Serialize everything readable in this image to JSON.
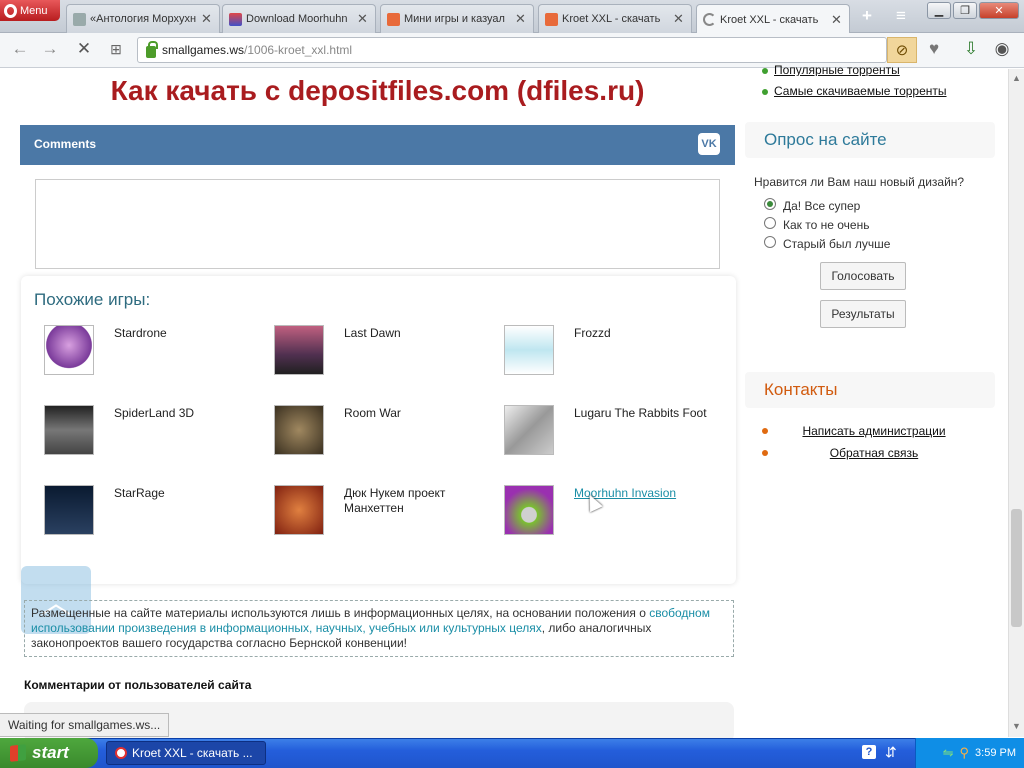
{
  "browser": {
    "menu_label": "Menu",
    "tabs": [
      {
        "title": "«Антология Морхухн"
      },
      {
        "title": "Download Moorhuhn"
      },
      {
        "title": "Мини игры и казуал"
      },
      {
        "title": "Kroet XXL - скачать"
      },
      {
        "title": "Kroet XXL - скачать"
      }
    ],
    "url_host": "smallgames.ws",
    "url_path": "/1006-kroet_xxl.html",
    "status": "Waiting for smallgames.ws..."
  },
  "page": {
    "download_heading": "Как качать с depositfiles.com (dfiles.ru)",
    "comments_label": "Comments",
    "vk_label": "VK",
    "similar_title": "Похожие игры:",
    "similar_games": [
      {
        "name": "Stardrone",
        "color": "#c070c0"
      },
      {
        "name": "Last Dawn",
        "color": "#804060"
      },
      {
        "name": "Frozzd",
        "color": "#bfe6f0"
      },
      {
        "name": "SpiderLand 3D",
        "color": "#555555"
      },
      {
        "name": "Room War",
        "color": "#6b5a3a"
      },
      {
        "name": "Lugaru The Rabbits Foot",
        "color": "#b8bcc0"
      },
      {
        "name": "StarRage",
        "color": "#1a2a40"
      },
      {
        "name": "Дюк Нукем проект Манхеттен",
        "color": "#a04020"
      },
      {
        "name": "Moorhuhn Invasion",
        "color": "#8a2aa0"
      }
    ],
    "disclaimer": {
      "part1": "Размещенные на сайте материалы используются лишь в информационных целях, на основании положения о ",
      "link1": "свободном использовании произведения в информационных, научных, учебных или культурных целях",
      "part2": ", либо аналогичных законопроектов вашего государства согласно Бернской конвенции!"
    },
    "user_comments_title": "Комментарии от пользователей сайта"
  },
  "sidebar": {
    "torrent_links": [
      "Популярные торренты",
      "Самые скачиваемые торренты"
    ],
    "poll": {
      "title": "Опрос на сайте",
      "question": "Нравится ли Вам наш новый дизайн?",
      "options": [
        {
          "label": "Да! Все супер",
          "checked": true
        },
        {
          "label": "Как то не очень",
          "checked": false
        },
        {
          "label": "Старый был лучше",
          "checked": false
        }
      ],
      "vote_label": "Голосовать",
      "results_label": "Результаты"
    },
    "contacts": {
      "title": "Контакты",
      "links": [
        "Написать администрации",
        "Обратная связь"
      ]
    }
  },
  "taskbar": {
    "start_label": "start",
    "task_item": "Kroet XXL - скачать ...",
    "clock": "3:59 PM"
  },
  "colors": {
    "heading_red": "#a91c1f",
    "comments_blue": "#4b78a6",
    "link_teal": "#1a8ea6",
    "contacts_orange": "#d15b0f",
    "poll_title_blue": "#2e7a9a"
  }
}
